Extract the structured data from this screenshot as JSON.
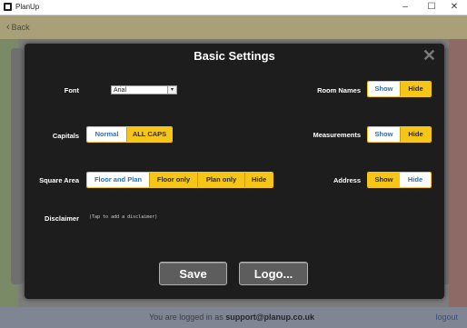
{
  "window": {
    "title": "PlanUp",
    "minimize": "–",
    "maximize": "☐",
    "close": "✕"
  },
  "header": {
    "back_label": "Back"
  },
  "modal": {
    "title": "Basic Settings",
    "close": "✕",
    "font": {
      "label": "Font",
      "value": "Arial",
      "dropdown_icon": "▾"
    },
    "capitals": {
      "label": "Capitals",
      "options": [
        "Normal",
        "ALL CAPS"
      ],
      "selected": "Normal"
    },
    "square_area": {
      "label": "Square Area",
      "options": [
        "Floor and Plan",
        "Floor only",
        "Plan only",
        "Hide"
      ],
      "selected": "Floor and Plan"
    },
    "disclaimer": {
      "label": "Disclaimer",
      "hint": "(Tap to add a disclaimer)"
    },
    "room_names": {
      "label": "Room Names",
      "options": [
        "Show",
        "Hide"
      ],
      "selected": "Show"
    },
    "measurements": {
      "label": "Measurements",
      "options": [
        "Show",
        "Hide"
      ],
      "selected": "Show"
    },
    "address": {
      "label": "Address",
      "options": [
        "Show",
        "Hide"
      ],
      "selected": "Hide"
    },
    "save_label": "Save",
    "logo_label": "Logo..."
  },
  "footer": {
    "login_prefix": "You are logged in as",
    "email": "support@planup.co.uk",
    "logout": "logout"
  },
  "colors": {
    "accent": "#f5c518",
    "selected_text": "#2a6fb3",
    "header": "#a9a079"
  }
}
